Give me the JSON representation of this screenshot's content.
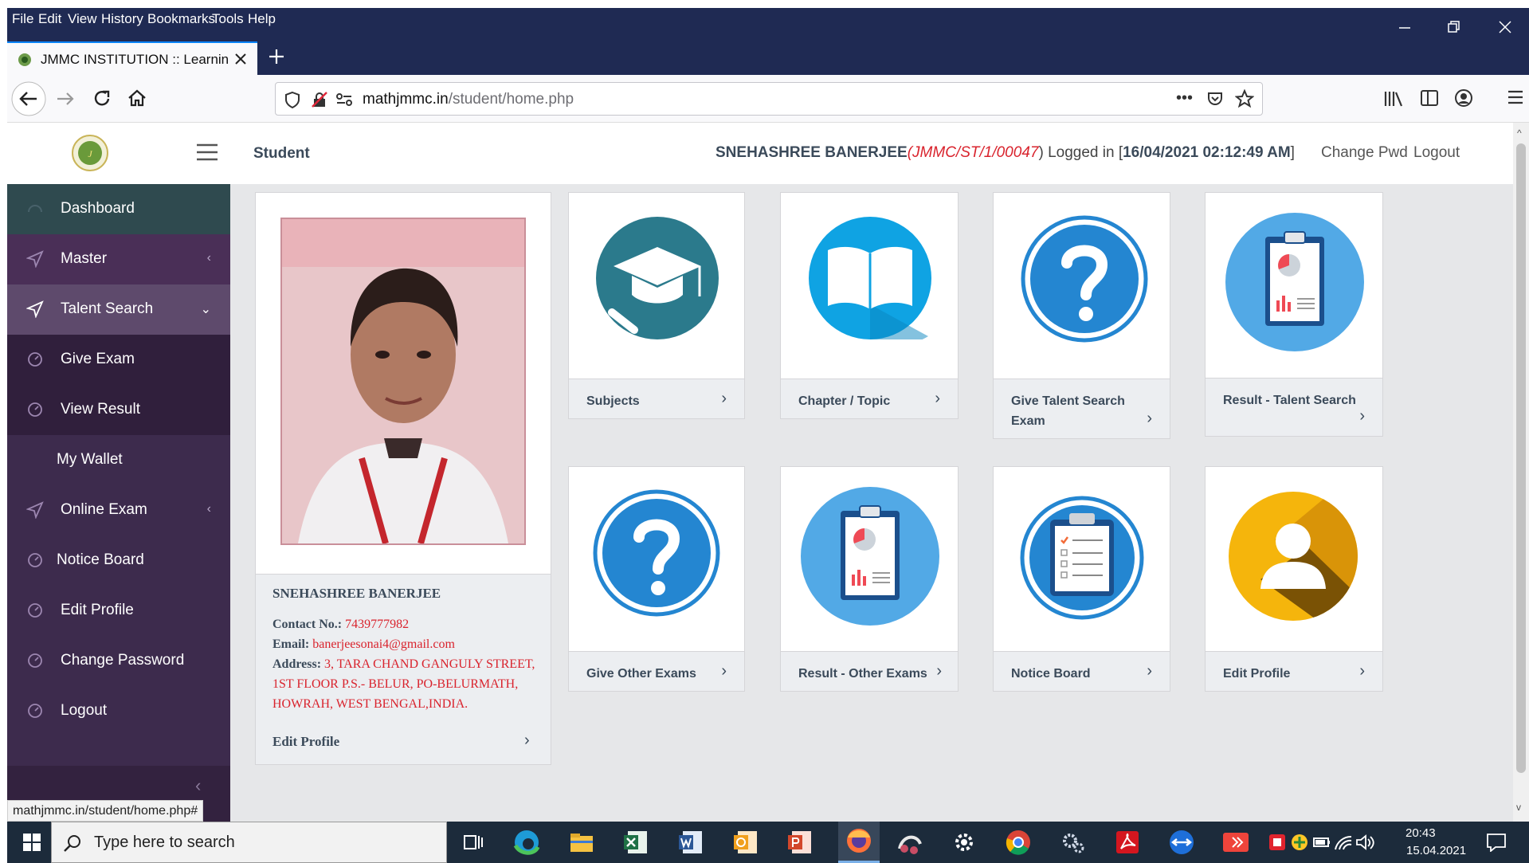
{
  "browser": {
    "menu": [
      "File",
      "Edit",
      "View",
      "History",
      "Bookmarks",
      "Tools",
      "Help"
    ],
    "tab_title": "JMMC INSTITUTION :: Learning",
    "url_domain": "mathjmmc.in",
    "url_path": "/student/home.php",
    "status_url": "mathjmmc.in/student/home.php#"
  },
  "header": {
    "section": "Student",
    "user_name": "SNEHASHREE BANERJEE",
    "user_id": "(JMMC/ST/1/00047",
    "logged_in_prefix": ") Logged in [",
    "login_time": "16/04/2021 02:12:49 AM",
    "logged_in_suffix": "]",
    "change_pwd": "Change Pwd",
    "logout": "Logout"
  },
  "sidebar": {
    "items": [
      {
        "label": "Dashboard"
      },
      {
        "label": "Master"
      },
      {
        "label": "Talent Search"
      },
      {
        "label": "Give Exam"
      },
      {
        "label": "View Result"
      },
      {
        "label": "My Wallet"
      },
      {
        "label": "Online Exam"
      },
      {
        "label": "Notice Board"
      },
      {
        "label": "Edit Profile"
      },
      {
        "label": "Change Password"
      },
      {
        "label": "Logout"
      }
    ]
  },
  "profile": {
    "name": "SNEHASHREE BANERJEE",
    "contact_label": "Contact No.:",
    "contact": "7439777982",
    "email_label": "Email:",
    "email": "banerjeesonai4@gmail.com",
    "address_label": "Address:",
    "address_l1": "3, TARA CHAND GANGULY STREET,",
    "address_l2": "1ST FLOOR P.S.- BELUR, PO-BELURMATH,",
    "address_l3": "HOWRAH, WEST BENGAL,INDIA.",
    "edit_link": "Edit Profile"
  },
  "tiles": [
    {
      "line1": "Subjects",
      "line2": "",
      "icon": "graduation-cap-icon"
    },
    {
      "line1": "Chapter / Topic",
      "line2": "",
      "icon": "open-book-icon"
    },
    {
      "line1": "Give Talent Search",
      "line2": "Exam",
      "icon": "question-mark-icon"
    },
    {
      "line1": "Result - Talent Search",
      "line2": "",
      "icon": "clipboard-report-icon"
    },
    {
      "line1": "Give Other Exams",
      "line2": "",
      "icon": "question-mark-icon"
    },
    {
      "line1": "Result - Other Exams",
      "line2": "",
      "icon": "clipboard-report-icon"
    },
    {
      "line1": "Notice Board",
      "line2": "",
      "icon": "clipboard-checklist-icon"
    },
    {
      "line1": "Edit Profile",
      "line2": "",
      "icon": "user-silhouette-icon"
    }
  ],
  "taskbar": {
    "search_placeholder": "Type here to search",
    "time": "20:43",
    "date": "15.04.2021"
  },
  "colors": {
    "sidebar": "#3d2b4d",
    "sidebar_active": "#2f4a4f",
    "accent_red": "#d9232d",
    "browser_chrome": "#1f2a53"
  }
}
